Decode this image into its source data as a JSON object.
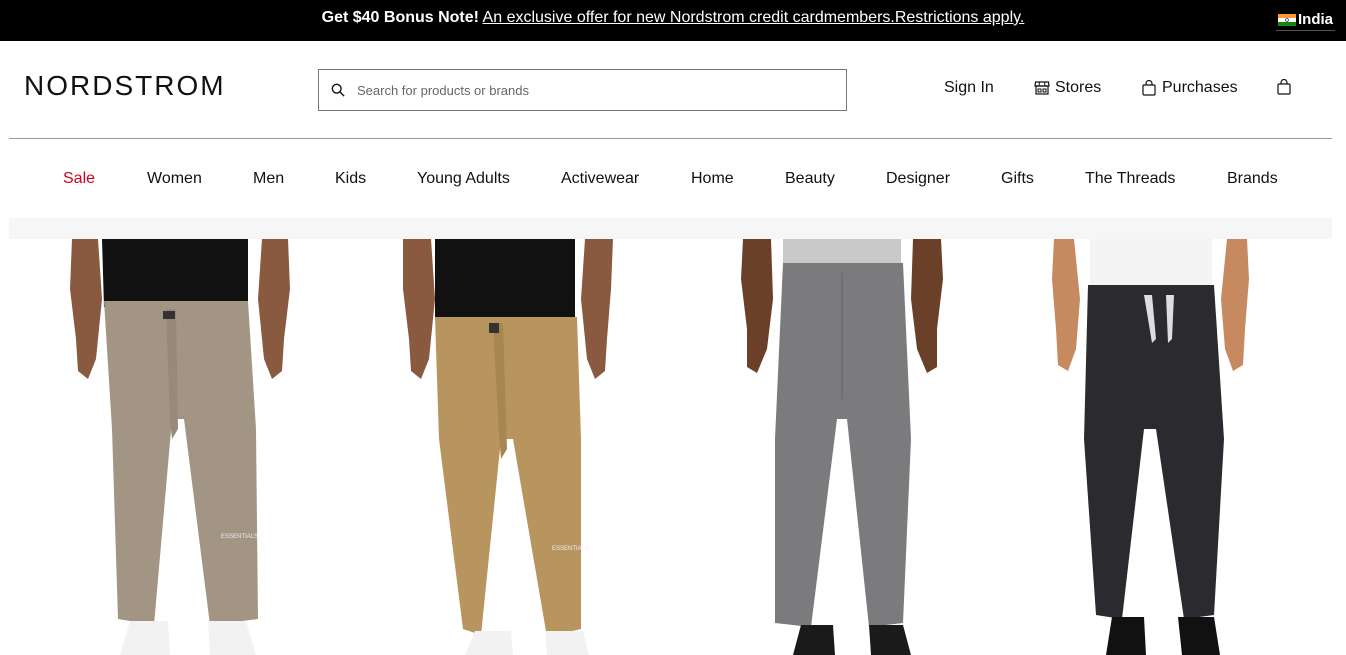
{
  "promo": {
    "bold": "Get $40 Bonus Note!",
    "link": "An exclusive offer for new Nordstrom credit cardmembers.Restrictions apply.",
    "country": "India"
  },
  "header": {
    "logo": "NORDSTROM",
    "search_placeholder": "Search for products or brands",
    "sign_in": "Sign In",
    "stores": "Stores",
    "purchases": "Purchases"
  },
  "nav": [
    {
      "label": "Sale"
    },
    {
      "label": "Women"
    },
    {
      "label": "Men"
    },
    {
      "label": "Kids"
    },
    {
      "label": "Young Adults"
    },
    {
      "label": "Activewear"
    },
    {
      "label": "Home"
    },
    {
      "label": "Beauty"
    },
    {
      "label": "Designer"
    },
    {
      "label": "Gifts"
    },
    {
      "label": "The Threads"
    },
    {
      "label": "Brands"
    }
  ],
  "products": [
    {
      "image": "taupe-sweatpants",
      "logo_text": "ESSENTIALS"
    },
    {
      "image": "tan-sweatpants",
      "logo_text": "ESSENTIALS"
    },
    {
      "image": "grey-chinos"
    },
    {
      "image": "black-joggers"
    }
  ],
  "colors": {
    "promo_bg": "#000000",
    "sale_red": "#d0021b",
    "band_grey": "#f6f6f6"
  }
}
